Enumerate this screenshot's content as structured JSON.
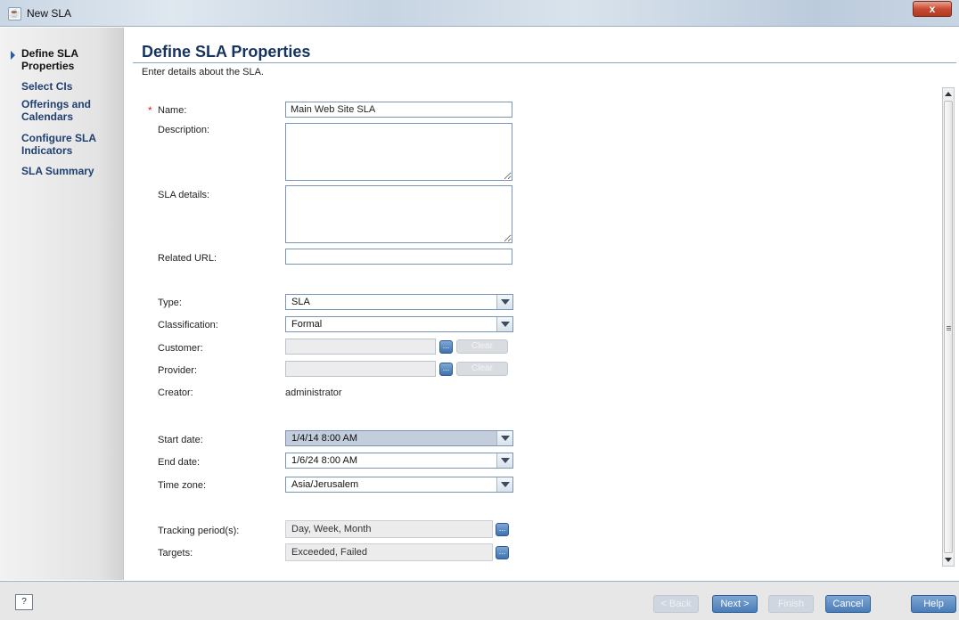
{
  "window": {
    "title": "New SLA",
    "close_label": "x",
    "app_icon": "java-cup-icon"
  },
  "sidebar": {
    "items": [
      {
        "label": "Define SLA Properties",
        "active": true
      },
      {
        "label": "Select CIs"
      },
      {
        "label": "Offerings and Calendars"
      },
      {
        "label": "Configure SLA Indicators"
      },
      {
        "label": "SLA Summary"
      }
    ]
  },
  "page": {
    "title": "Define SLA Properties",
    "subtitle": "Enter details about the SLA."
  },
  "form": {
    "required_mark": "*",
    "name": {
      "label": "Name:",
      "value": "Main Web Site SLA"
    },
    "description": {
      "label": "Description:",
      "value": ""
    },
    "sla_details": {
      "label": "SLA details:",
      "value": ""
    },
    "related_url": {
      "label": "Related URL:",
      "value": ""
    },
    "type": {
      "label": "Type:",
      "value": "SLA"
    },
    "classification": {
      "label": "Classification:",
      "value": "Formal"
    },
    "customer": {
      "label": "Customer:",
      "value": "",
      "clear_label": "Clear"
    },
    "provider": {
      "label": "Provider:",
      "value": "",
      "clear_label": "Clear"
    },
    "creator": {
      "label": "Creator:",
      "value": "administrator"
    },
    "start_date": {
      "label": "Start date:",
      "value": "1/4/14 8:00 AM"
    },
    "end_date": {
      "label": "End date:",
      "value": "1/6/24 8:00 AM"
    },
    "time_zone": {
      "label": "Time zone:",
      "value": "Asia/Jerusalem"
    },
    "tracking_periods": {
      "label": "Tracking period(s):",
      "value": "Day, Week, Month"
    },
    "targets": {
      "label": "Targets:",
      "value": "Exceeded, Failed"
    },
    "browse_label": "..."
  },
  "footer": {
    "help_icon_label": "?",
    "back_label": "< Back",
    "next_label": "Next >",
    "finish_label": "Finish",
    "cancel_label": "Cancel",
    "help_label": "Help"
  }
}
